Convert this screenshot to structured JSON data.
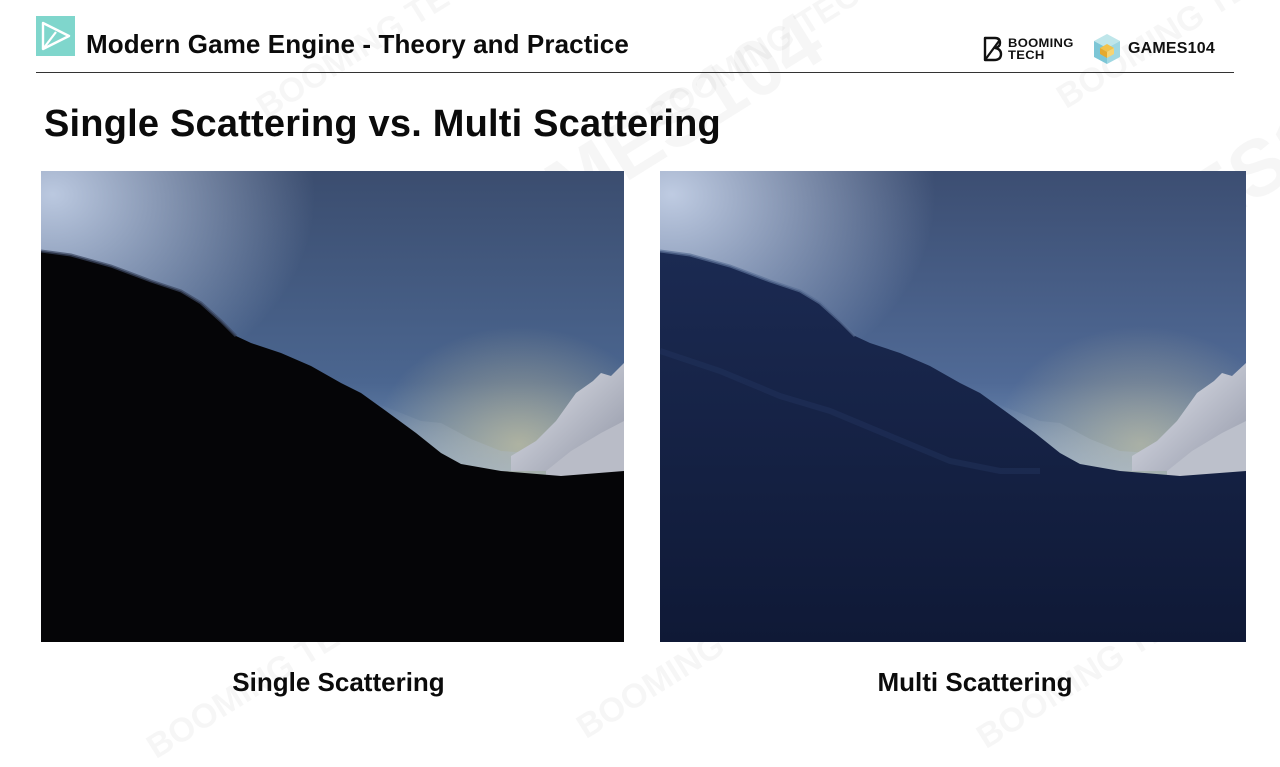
{
  "header": {
    "title": "Modern Game Engine - Theory and Practice",
    "logo_icon": "play-triangle-icon",
    "brands": {
      "booming": "BOOMING\nTECH",
      "games": "GAMES104"
    }
  },
  "slide": {
    "title": "Single Scattering vs. Multi Scattering"
  },
  "figures": [
    {
      "caption": "Single Scattering",
      "icon": "mountain-valley-render-dark"
    },
    {
      "caption": "Multi Scattering",
      "icon": "mountain-valley-render-blue"
    }
  ],
  "colors": {
    "logo_tile": "#7fd6cc",
    "sky_top": "#3d5072",
    "sky_horizon": "#8ea9c6",
    "ground_single": "#050507",
    "ground_multi": "#111c3a",
    "snow": "#d9dce6"
  }
}
